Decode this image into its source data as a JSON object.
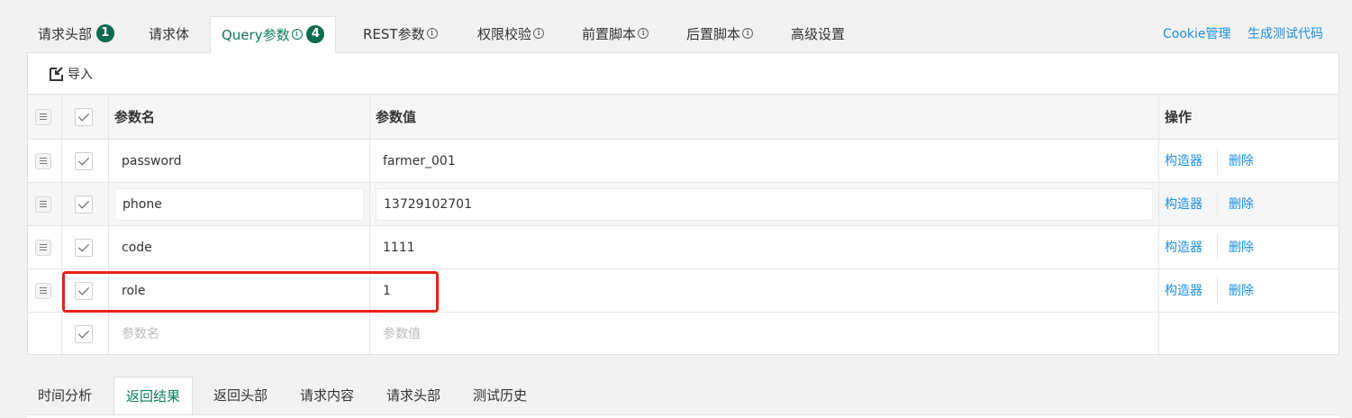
{
  "top_tabs": [
    {
      "label": "请求头部",
      "badge": "1"
    },
    {
      "label": "请求体"
    },
    {
      "label": "Query参数",
      "badge": "4",
      "info": "i",
      "active": true
    },
    {
      "label": "REST参数",
      "info": "i"
    },
    {
      "label": "权限校验",
      "info": "i"
    },
    {
      "label": "前置脚本",
      "info": "i"
    },
    {
      "label": "后置脚本",
      "info": "i"
    },
    {
      "label": "高级设置"
    }
  ],
  "top_links": {
    "cookie": "Cookie管理",
    "gen_code": "生成测试代码"
  },
  "toolbar": {
    "import_label": "导入",
    "import_icon": "import-icon"
  },
  "table": {
    "headers": {
      "name": "参数名",
      "value": "参数值",
      "operation": "操作"
    },
    "rows": [
      {
        "name": "password",
        "value": "farmer_001",
        "checked": true
      },
      {
        "name": "phone",
        "value": "13729102701",
        "checked": true
      },
      {
        "name": "code",
        "value": "1111",
        "checked": true
      },
      {
        "name": "role",
        "value": "1",
        "checked": true
      }
    ],
    "new_row": {
      "name_placeholder": "参数名",
      "value_placeholder": "参数值",
      "checked": true
    },
    "actions": {
      "builder": "构造器",
      "delete": "删除"
    }
  },
  "highlight_color": "#e8211a",
  "accent_color": "#0d7a5f",
  "link_color": "#1e90e0",
  "bottom_tabs": [
    {
      "label": "时间分析"
    },
    {
      "label": "返回结果",
      "active": true
    },
    {
      "label": "返回头部"
    },
    {
      "label": "请求内容"
    },
    {
      "label": "请求头部"
    },
    {
      "label": "测试历史"
    }
  ]
}
